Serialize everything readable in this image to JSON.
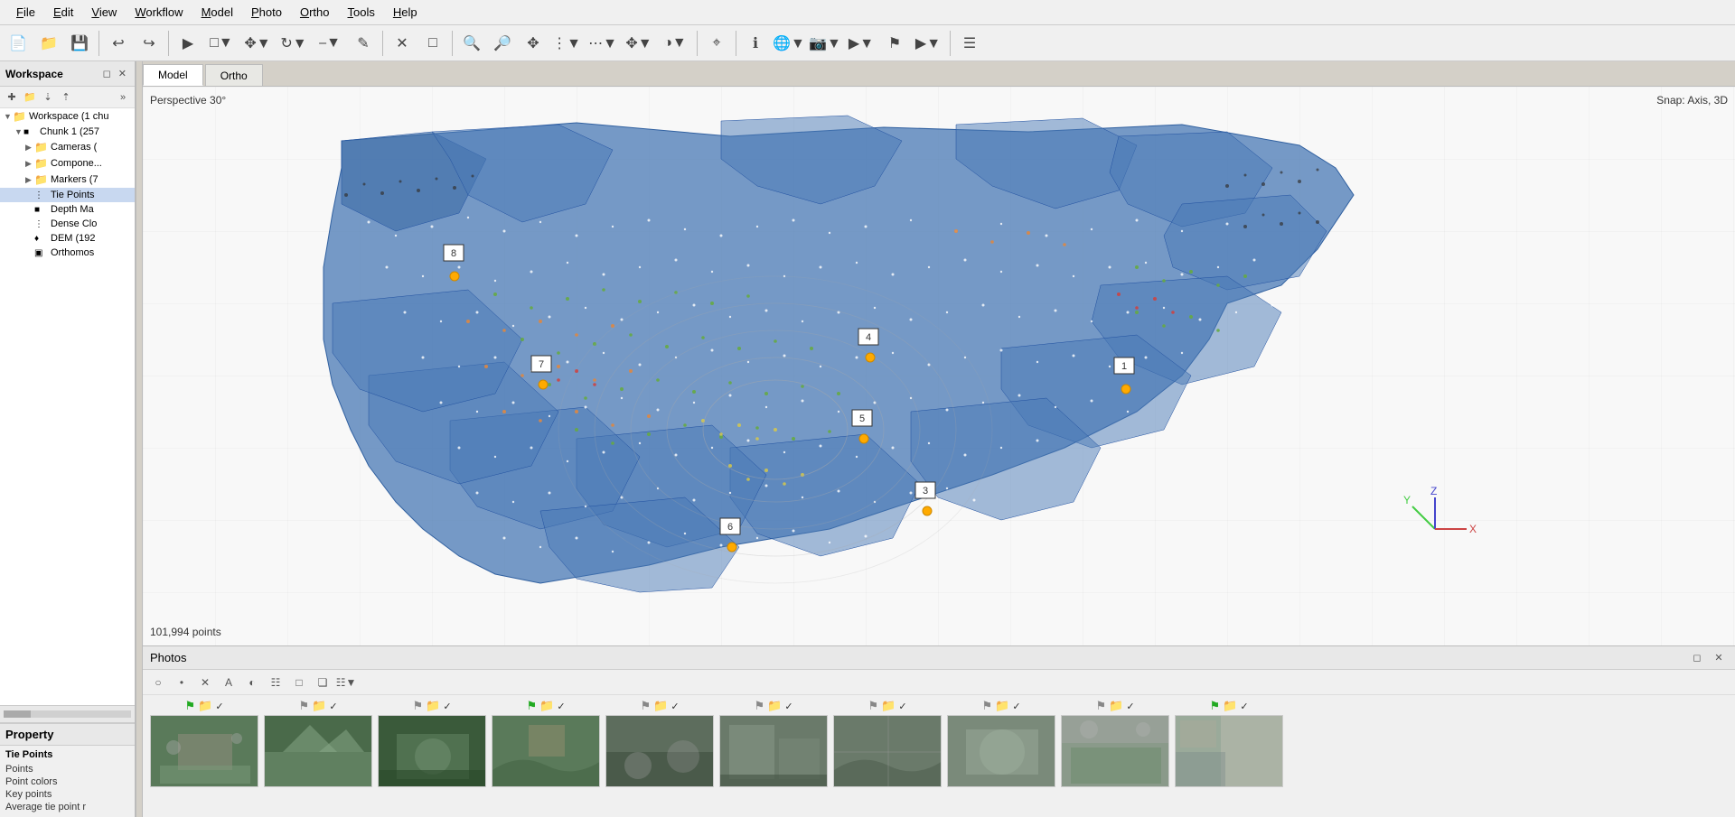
{
  "menubar": {
    "items": [
      {
        "label": "File",
        "underline": "F"
      },
      {
        "label": "Edit",
        "underline": "E"
      },
      {
        "label": "View",
        "underline": "V"
      },
      {
        "label": "Workflow",
        "underline": "W"
      },
      {
        "label": "Model",
        "underline": "M"
      },
      {
        "label": "Photo",
        "underline": "P"
      },
      {
        "label": "Ortho",
        "underline": "O"
      },
      {
        "label": "Tools",
        "underline": "T"
      },
      {
        "label": "Help",
        "underline": "H"
      }
    ]
  },
  "workspace": {
    "title": "Workspace",
    "chunk_label": "Workspace (1 chu",
    "chunk1_label": "Chunk 1 (257",
    "cameras_label": "Cameras (",
    "components_label": "Compone...",
    "markers_label": "Markers (7",
    "tie_points_label": "Tie Points",
    "depth_maps_label": "Depth Ma",
    "dense_cloud_label": "Dense Clo",
    "dem_label": "DEM (192",
    "orthomos_label": "Orthomos"
  },
  "tabs": [
    {
      "label": "Model",
      "active": true
    },
    {
      "label": "Ortho",
      "active": false
    }
  ],
  "viewport": {
    "perspective": "Perspective 30°",
    "snap": "Snap: Axis, 3D",
    "points_count": "101,994 points"
  },
  "property": {
    "title": "Property",
    "section": "Tie Points",
    "items": [
      {
        "label": "Points"
      },
      {
        "label": "Point colors"
      },
      {
        "label": "Key points"
      },
      {
        "label": "Average tie point r"
      }
    ]
  },
  "photos": {
    "title": "Photos",
    "items": [
      {
        "type": "aerial",
        "flag": true,
        "check": true
      },
      {
        "type": "road",
        "flag": false,
        "check": true
      },
      {
        "type": "park",
        "flag": false,
        "check": true
      },
      {
        "type": "aerial",
        "flag": true,
        "check": true
      },
      {
        "type": "road",
        "flag": false,
        "check": true
      },
      {
        "type": "park",
        "flag": false,
        "check": true
      },
      {
        "type": "building",
        "flag": false,
        "check": true
      },
      {
        "type": "aerial",
        "flag": false,
        "check": true
      },
      {
        "type": "road",
        "flag": false,
        "check": true
      },
      {
        "type": "building",
        "flag": true,
        "check": true
      }
    ]
  },
  "markers": [
    {
      "id": "1",
      "x": 73,
      "y": 33
    },
    {
      "id": "3",
      "x": 56,
      "y": 52
    },
    {
      "id": "4",
      "x": 50,
      "y": 30
    },
    {
      "id": "5",
      "x": 48,
      "y": 42
    },
    {
      "id": "6",
      "x": 38,
      "y": 56
    },
    {
      "id": "7",
      "x": 28,
      "y": 35
    },
    {
      "id": "8",
      "x": 22,
      "y": 18
    }
  ],
  "axis": {
    "x_color": "#ff4444",
    "y_color": "#44ff44",
    "z_color": "#4444ff"
  }
}
